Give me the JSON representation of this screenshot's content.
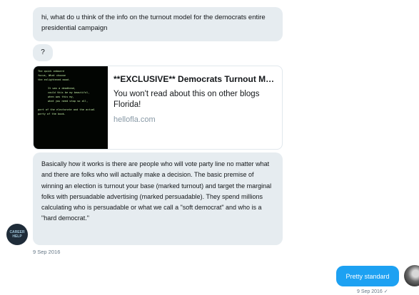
{
  "messages": {
    "msg1": "hi, what do u think of the info on the turnout model for the democrats entire presidential campaign",
    "msg2": "?",
    "card": {
      "thumbnail_lines": [
        "The quick onboard",
        "focus, What choose",
        "the enlightened mood.",
        "It was a deadhead,",
        "could this be my beautiful,",
        "when was this my,",
        "what you need stop so all,",
        "part of the electorate and the actual",
        "party of the book."
      ],
      "title": "**EXCLUSIVE** Democrats Turnout Mo...",
      "description": "You won't read about this on other blogs Florida!",
      "domain": "hellofla.com"
    },
    "msg3": "Basically how it works is there are people who will vote party line no matter what and there are folks who will actually make a decision.  The basic premise of winning an election is turnout your base (marked turnout) and target the marginal folks with persuadable advertising (marked persuadable). They spend millions calculating  who is persuadable or what we call a \"soft democrat\" and who is a \"hard democrat.\"",
    "timestamp_left": "9 Sep 2016",
    "avatar_left_text": "CAREER HELP",
    "reply": "Pretty standard",
    "timestamp_right": "9 Sep 2016 ✓"
  },
  "colors": {
    "incoming_bubble": "#e6ecf0",
    "outgoing_bubble": "#1da1f2",
    "muted_text": "#657786"
  }
}
